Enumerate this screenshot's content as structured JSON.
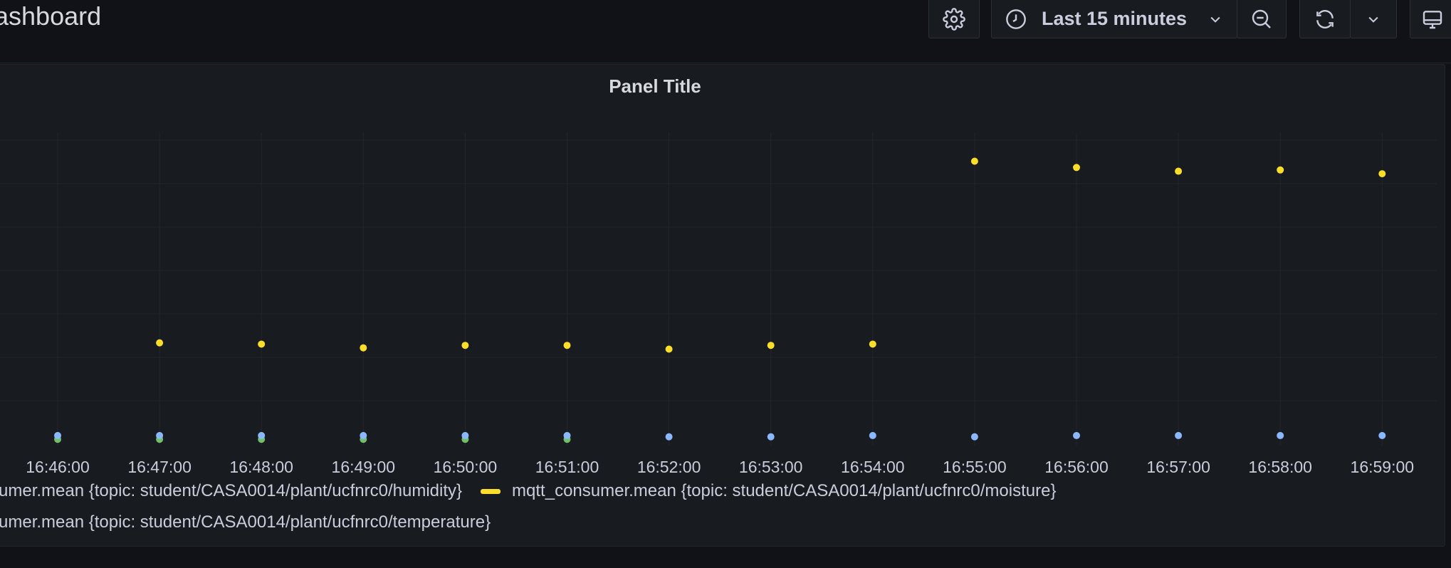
{
  "header": {
    "title": "ashboard",
    "time_range_label": "Last 15 minutes"
  },
  "panel": {
    "title": "Panel Title"
  },
  "chart_data": {
    "type": "scatter",
    "x": [
      "16:46:00",
      "16:47:00",
      "16:48:00",
      "16:49:00",
      "16:50:00",
      "16:51:00",
      "16:52:00",
      "16:53:00",
      "16:54:00",
      "16:55:00",
      "16:56:00",
      "16:57:00",
      "16:58:00",
      "16:59:00"
    ],
    "grid": true,
    "series": [
      {
        "name": "umer.mean {topic: student/CASA0014/plant/ucfnrc0/humidity}",
        "color": "#73bf69",
        "values": [
          0.05,
          0.05,
          0.05,
          0.05,
          0.05,
          0.05,
          null,
          null,
          null,
          null,
          null,
          null,
          null,
          null
        ]
      },
      {
        "name": "mqtt_consumer.mean {topic: student/CASA0014/plant/ucfnrc0/moisture}",
        "color": "#fade2a",
        "values": [
          null,
          0.82,
          0.81,
          0.78,
          0.8,
          0.8,
          0.77,
          0.8,
          0.81,
          2.27,
          2.22,
          2.19,
          2.2,
          2.17
        ]
      },
      {
        "name": "umer.mean {topic: student/CASA0014/plant/ucfnrc0/temperature}",
        "color": "#8ab8ff",
        "values": [
          0.08,
          0.08,
          0.08,
          0.08,
          0.08,
          0.08,
          0.07,
          0.07,
          0.08,
          0.07,
          0.08,
          0.08,
          0.08,
          0.08
        ]
      }
    ]
  }
}
